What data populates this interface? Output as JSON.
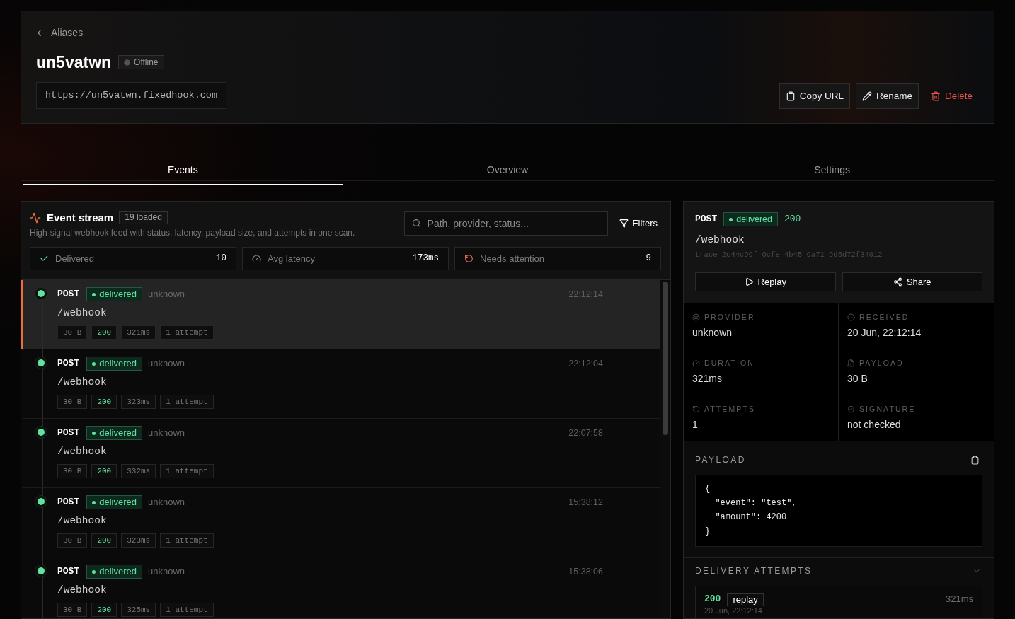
{
  "header": {
    "back_link": "Aliases",
    "title": "un5vatwn",
    "status": {
      "label": "Offline",
      "online": false
    },
    "url": "https://un5vatwn.fixedhook.com",
    "actions": [
      {
        "kind": "copy",
        "label": "Copy URL"
      },
      {
        "kind": "rename",
        "label": "Rename"
      },
      {
        "kind": "delete",
        "label": "Delete"
      }
    ]
  },
  "tabs": [
    {
      "label": "Events",
      "selected": true
    },
    {
      "label": "Overview",
      "selected": false
    },
    {
      "label": "Settings",
      "selected": false
    }
  ],
  "event_stream": {
    "title": "Event stream",
    "count": "19 loaded",
    "description": "High-signal webhook feed with status, latency, payload size, and attempts in one scan.",
    "search": {
      "placeholder": "Path, provider, status..."
    },
    "filters_button": "Filters",
    "stats": [
      {
        "kind": "delivered",
        "label": "Delivered",
        "value": "10"
      },
      {
        "kind": "latency",
        "label": "Avg latency",
        "value": "173ms"
      },
      {
        "kind": "attention",
        "label": "Needs attention",
        "value": "9"
      }
    ],
    "events": [
      {
        "method": "POST",
        "status": "delivered",
        "provider": "unknown",
        "time": "22:12:14",
        "path": "/webhook",
        "size": "30 B",
        "code": "200",
        "duration": "321ms",
        "attempts": "1 attempt",
        "selected": true
      },
      {
        "method": "POST",
        "status": "delivered",
        "provider": "unknown",
        "time": "22:12:04",
        "path": "/webhook",
        "size": "30 B",
        "code": "200",
        "duration": "323ms",
        "attempts": "1 attempt",
        "selected": false
      },
      {
        "method": "POST",
        "status": "delivered",
        "provider": "unknown",
        "time": "22:07:58",
        "path": "/webhook",
        "size": "30 B",
        "code": "200",
        "duration": "332ms",
        "attempts": "1 attempt",
        "selected": false
      },
      {
        "method": "POST",
        "status": "delivered",
        "provider": "unknown",
        "time": "15:38:12",
        "path": "/webhook",
        "size": "30 B",
        "code": "200",
        "duration": "323ms",
        "attempts": "1 attempt",
        "selected": false
      },
      {
        "method": "POST",
        "status": "delivered",
        "provider": "unknown",
        "time": "15:38:06",
        "path": "/webhook",
        "size": "30 B",
        "code": "200",
        "duration": "325ms",
        "attempts": "1 attempt",
        "selected": false
      }
    ]
  },
  "detail": {
    "method": "POST",
    "status": "delivered",
    "code": "200",
    "path": "/webhook",
    "trace": "trace 2c44c99f-0cfe-4b45-9a71-9d6d72f34012",
    "actions": [
      {
        "kind": "replay",
        "label": "Replay"
      },
      {
        "kind": "share",
        "label": "Share"
      }
    ],
    "fields": [
      {
        "kind": "provider",
        "label": "PROVIDER",
        "value": "unknown"
      },
      {
        "kind": "received",
        "label": "RECEIVED",
        "value": "20 Jun, 22:12:14"
      },
      {
        "kind": "duration",
        "label": "DURATION",
        "value": "321ms"
      },
      {
        "kind": "payload",
        "label": "PAYLOAD",
        "value": "30 B"
      },
      {
        "kind": "attempts",
        "label": "ATTEMPTS",
        "value": "1"
      },
      {
        "kind": "signature",
        "label": "SIGNATURE",
        "value": "not checked"
      }
    ],
    "payload": {
      "title": "PAYLOAD",
      "code": "{\n  \"event\": \"test\",\n  \"amount\": 4200\n}"
    },
    "delivery_attempts": {
      "title": "DELIVERY ATTEMPTS",
      "expanded": true,
      "items": [
        {
          "code": "200",
          "tag": "replay",
          "duration": "321ms",
          "time": "20 Jun, 22:12:14"
        }
      ]
    }
  }
}
